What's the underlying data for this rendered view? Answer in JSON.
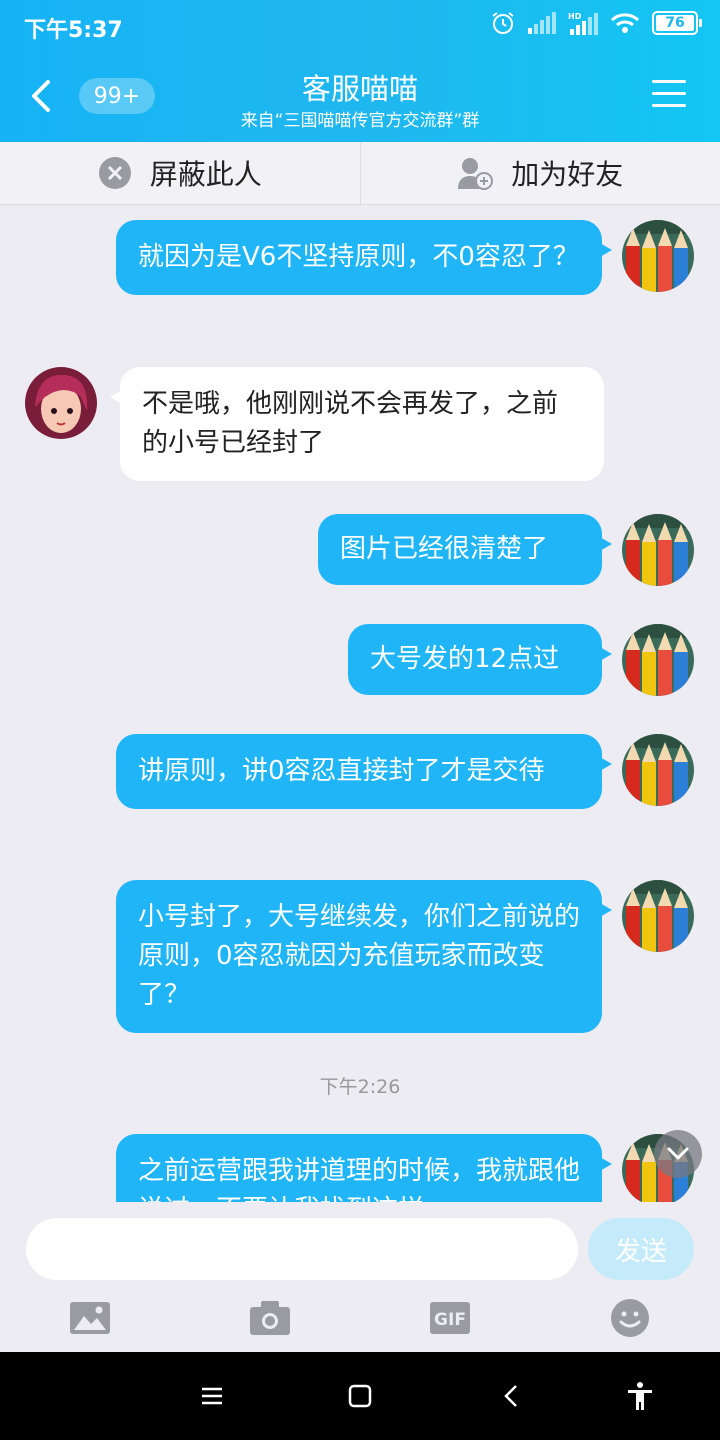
{
  "status": {
    "time": "下午5:37",
    "battery": "76"
  },
  "header": {
    "badge": "99+",
    "title": "客服喵喵",
    "subtitle": "来自“三国喵喵传官方交流群”群"
  },
  "actions": {
    "block_label": "屏蔽此人",
    "add_friend_label": "加为好友"
  },
  "messages": [
    {
      "from": "me",
      "text": "就因为是V6不坚持原则，不0容忍了？"
    },
    {
      "from": "other",
      "text": "不是哦，他刚刚说不会再发了，之前的小号已经封了"
    },
    {
      "from": "me",
      "text": "图片已经很清楚了"
    },
    {
      "from": "me",
      "text": "大号发的12点过"
    },
    {
      "from": "me",
      "text": "讲原则，讲0容忍直接封了才是交待"
    },
    {
      "from": "me",
      "text": "小号封了，大号继续发，你们之前说的原则，0容忍就因为充值玩家而改变了？"
    },
    {
      "from": "me",
      "text": "之前运营跟我讲道理的时候，我就跟他说过，不要让我找到这样"
    }
  ],
  "timestamp": "下午2:26",
  "input": {
    "send_label": "发送",
    "placeholder": ""
  },
  "toolbar": {
    "icons": [
      "image-icon",
      "camera-icon",
      "gif-icon",
      "emoji-icon"
    ],
    "gif_label": "GIF"
  },
  "colors": {
    "header": "#1fb7ef",
    "my_bubble": "#1fb5f6",
    "send_disabled": "#c5ebfb"
  }
}
